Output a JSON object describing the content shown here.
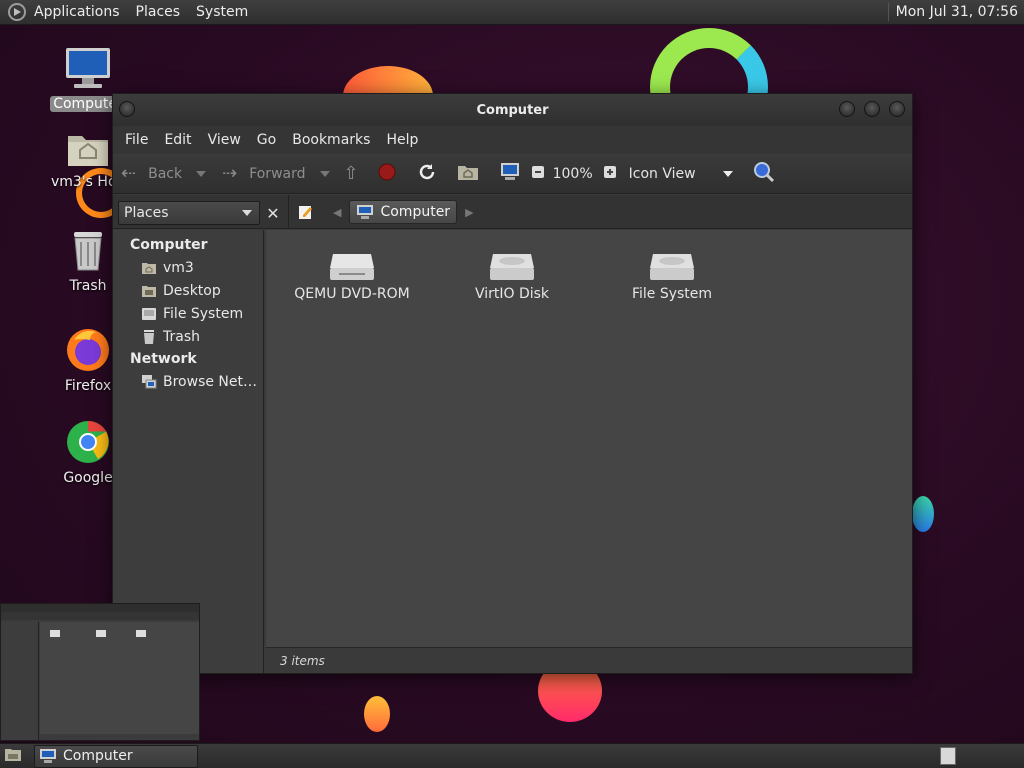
{
  "top_panel": {
    "menus": [
      "Applications",
      "Places",
      "System"
    ],
    "clock": "Mon Jul 31, 07:56"
  },
  "desktop": {
    "icons": [
      {
        "label": "Computer",
        "icon": "computer-icon"
      },
      {
        "label": "vm3's Home",
        "icon": "home-folder-icon"
      },
      {
        "label": "Trash",
        "icon": "trash-icon"
      },
      {
        "label": "Firefox",
        "icon": "firefox-icon"
      },
      {
        "label": "Google",
        "icon": "chrome-icon"
      }
    ]
  },
  "window": {
    "title": "Computer",
    "menubar": [
      "File",
      "Edit",
      "View",
      "Go",
      "Bookmarks",
      "Help"
    ],
    "toolbar": {
      "back": "Back",
      "forward": "Forward",
      "zoom": "100%",
      "view_mode": "Icon View"
    },
    "sidebar": {
      "selector": "Places",
      "sections": [
        {
          "heading": "Computer",
          "items": [
            "vm3",
            "Desktop",
            "File System",
            "Trash"
          ]
        },
        {
          "heading": "Network",
          "items": [
            "Browse Net…"
          ]
        }
      ]
    },
    "location": "Computer",
    "items": [
      {
        "label": "QEMU DVD-ROM",
        "icon": "optical-drive-icon"
      },
      {
        "label": "VirtIO Disk",
        "icon": "hard-disk-icon"
      },
      {
        "label": "File System",
        "icon": "hard-disk-icon"
      }
    ],
    "status": "3 items"
  },
  "taskbar": {
    "task_label": "Computer"
  },
  "colors": {
    "desktop_bg": "#2a0b24",
    "window_bg": "#454545",
    "panel_bg": "#353535"
  }
}
